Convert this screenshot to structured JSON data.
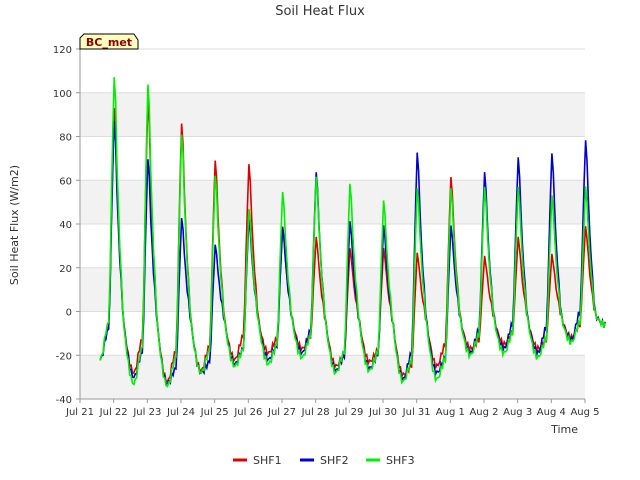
{
  "chart_data": {
    "type": "line",
    "title": "Soil Heat Flux",
    "xlabel": "Time",
    "ylabel": "Soil Heat Flux (W/m2)",
    "site_badge": "BC_met",
    "ylim": [
      -40,
      120
    ],
    "y_ticks": [
      -40,
      -20,
      0,
      20,
      40,
      60,
      80,
      100,
      120
    ],
    "xlim": [
      "Jul 21",
      "Aug 5"
    ],
    "x_ticks": [
      "Jul 21",
      "Jul 22",
      "Jul 23",
      "Jul 24",
      "Jul 25",
      "Jul 26",
      "Jul 27",
      "Jul 28",
      "Jul 29",
      "Jul 30",
      "Jul 31",
      "Aug 1",
      "Aug 2",
      "Aug 3",
      "Aug 4",
      "Aug 5"
    ],
    "grid": "horizontal bands",
    "legend_position": "bottom-center",
    "days": [
      "Jul 21",
      "Jul 22",
      "Jul 23",
      "Jul 24",
      "Jul 25",
      "Jul 26",
      "Jul 27",
      "Jul 28",
      "Jul 29",
      "Jul 30",
      "Jul 31",
      "Aug 1",
      "Aug 2",
      "Aug 3"
    ],
    "series": [
      {
        "name": "SHF1",
        "color": "#dd0000",
        "daily_peak": [
          97,
          101,
          90,
          72,
          70,
          40,
          35,
          30,
          30,
          28,
          64,
          26,
          35,
          27,
          40
        ],
        "daily_min": [
          -28,
          -32,
          -27,
          -22,
          -19,
          -17,
          -25,
          -23,
          -29,
          -25,
          -17,
          -15,
          -17,
          -12,
          -6
        ]
      },
      {
        "name": "SHF2",
        "color": "#0000cc",
        "daily_peak": [
          91,
          73,
          45,
          32,
          44,
          40,
          66,
          43,
          41,
          76,
          41,
          66,
          73,
          75,
          81
        ],
        "daily_min": [
          -30,
          -33,
          -28,
          -24,
          -22,
          -19,
          -27,
          -26,
          -31,
          -28,
          -19,
          -17,
          -19,
          -13,
          -6
        ]
      },
      {
        "name": "SHF3",
        "color": "#00ee00",
        "daily_peak": [
          112,
          109,
          85,
          65,
          49,
          57,
          64,
          61,
          53,
          59,
          59,
          59,
          59,
          55,
          59
        ],
        "daily_min": [
          -33,
          -34,
          -28,
          -25,
          -24,
          -21,
          -28,
          -27,
          -32,
          -31,
          -20,
          -19,
          -21,
          -14,
          -6
        ]
      }
    ],
    "last_point": {
      "date": "Aug 4",
      "value": -6
    }
  }
}
